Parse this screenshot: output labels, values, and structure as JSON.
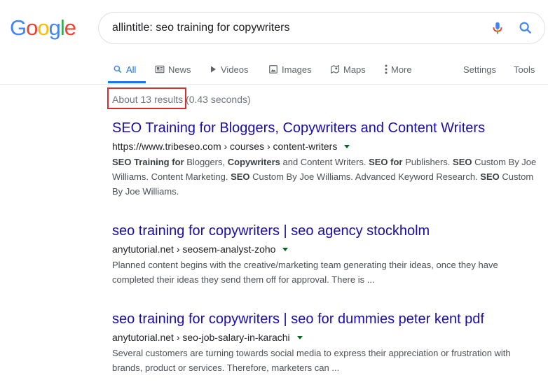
{
  "logo": {
    "letters": [
      {
        "ch": "G",
        "color": "#4285F4"
      },
      {
        "ch": "o",
        "color": "#EA4335"
      },
      {
        "ch": "o",
        "color": "#FBBC05"
      },
      {
        "ch": "g",
        "color": "#4285F4"
      },
      {
        "ch": "l",
        "color": "#34A853"
      },
      {
        "ch": "e",
        "color": "#EA4335"
      }
    ]
  },
  "search": {
    "query": "allintitle: seo training for copywriters"
  },
  "tabs": {
    "all": "All",
    "news": "News",
    "videos": "Videos",
    "images": "Images",
    "maps": "Maps",
    "more": "More",
    "settings": "Settings",
    "tools": "Tools"
  },
  "stats": {
    "count": "About 13 results",
    "time": "(0.43 seconds)"
  },
  "results": [
    {
      "title": "SEO Training for Bloggers, Copywriters and Content Writers",
      "url": "https://www.tribeseo.com › courses › content-writers",
      "snippet_html": "<b>SEO Training for</b> Bloggers, <b>Copywriters</b> and Content Writers. <b>SEO for</b> Publishers. <b>SEO</b> Custom By Joe Williams. Content Marketing. <b>SEO</b> Custom By Joe Williams. Advanced Keyword Research. <b>SEO</b> Custom By Joe Williams."
    },
    {
      "title": "seo training for copywriters | seo agency stockholm",
      "url": "anytutorial.net › seosem-analyst-zoho",
      "snippet_html": "Planned content begins with the creative/marketing team generating their ideas, once they have completed their ideas they send them off for approval. There is ..."
    },
    {
      "title": "seo training for copywriters | seo for dummies peter kent pdf",
      "url": "anytutorial.net › seo-job-salary-in-karachi",
      "snippet_html": "Several customers are turning towards social media to express their appreciation or frustration with brands, product or services. Therefore, marketers can ..."
    }
  ],
  "colors": {
    "link": "#1a0dab",
    "accent": "#1a73e8",
    "highlight": "#d32f2f"
  }
}
